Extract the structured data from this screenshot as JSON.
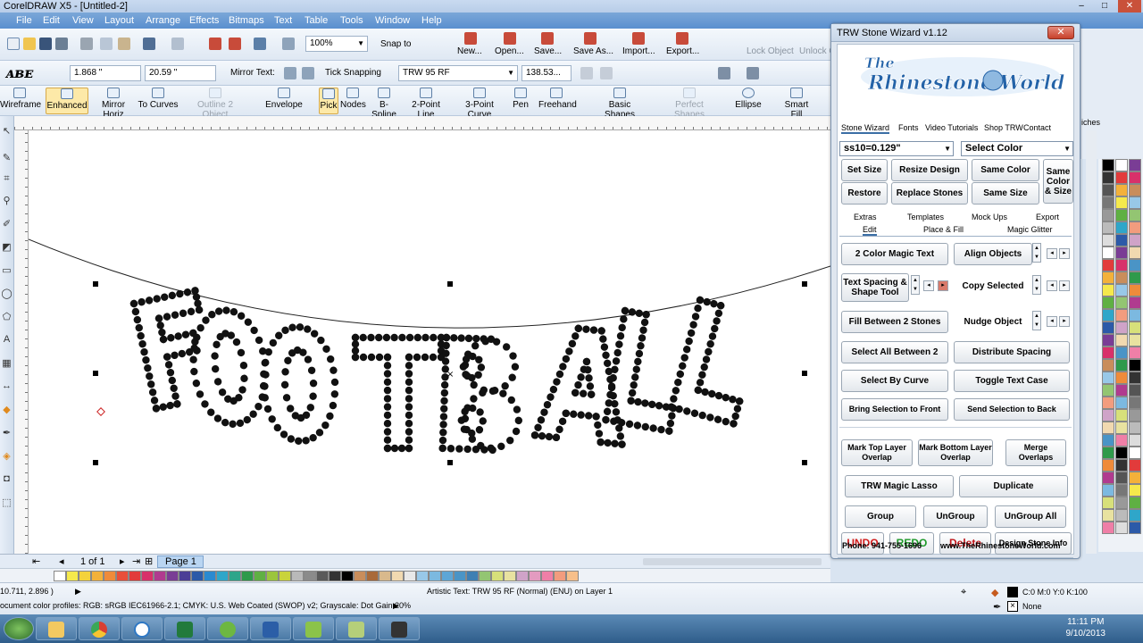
{
  "window": {
    "title": "CorelDRAW X5 - [Untitled-2]"
  },
  "menu": [
    "File",
    "Edit",
    "View",
    "Layout",
    "Arrange",
    "Effects",
    "Bitmaps",
    "Text",
    "Table",
    "Tools",
    "Window",
    "Help"
  ],
  "toolbar1": {
    "zoom": "100%",
    "snap_to": "Snap to",
    "new": "New...",
    "open": "Open...",
    "save": "Save...",
    "save_as": "Save As...",
    "import": "Import...",
    "export": "Export...",
    "lock_object": "Lock Object",
    "unlock_object": "Unlock O"
  },
  "toolbar2": {
    "width": "1.868 \"",
    "height": "20.59 \"",
    "mirror_text": "Mirror Text:",
    "tick_snapping": "Tick Snapping",
    "font": "TRW 95 RF",
    "size": "138.53..."
  },
  "toolbar3": [
    "Wireframe",
    "Enhanced",
    "Mirror Horiz",
    "To Curves",
    "Outline 2 Object",
    "Envelope",
    "Pick",
    "Nodes",
    "B-Spline",
    "2-Point Line",
    "3-Point Curve",
    "Pen",
    "Freehand",
    "Basic Shapes",
    "Perfect Shapes",
    "Ellipse",
    "Smart Fill"
  ],
  "pagebar": {
    "count": "1 of 1",
    "tab": "Page 1"
  },
  "status": {
    "coords": "10.711, 2.896 )",
    "object": "Artistic Text: TRW 95 RF (Normal) (ENU) on Layer 1",
    "profile": "ocument color profiles: RGB: sRGB IEC61966-2.1; CMYK: U.S. Web Coated (SWOP) v2; Grayscale: Dot Gain 20%",
    "fill": "C:0 M:0 Y:0 K:100",
    "outline": "None"
  },
  "clock": {
    "time": "11:11 PM",
    "date": "9/10/2013"
  },
  "dock": {
    "label": "iches"
  },
  "wizard": {
    "title": "TRW Stone Wizard v1.12",
    "close": "✕",
    "logo_top": "The",
    "logo_main": "Rhinestone World",
    "tabs": [
      "Stone Wizard",
      "Fonts",
      "Video Tutorials",
      "Shop TRW",
      "Contact"
    ],
    "stone_size": "ss10=0.129\"",
    "color_select": "Select Color",
    "set_size": "Set Size",
    "resize_design": "Resize Design",
    "same_color": "Same Color",
    "same_color_size": "Same Color & Size",
    "restore": "Restore",
    "replace_stones": "Replace Stones",
    "same_size": "Same Size",
    "subtabs_row1": [
      "Extras",
      "Templates",
      "Mock Ups",
      "Export"
    ],
    "subtabs_row2": [
      "Edit",
      "Place & Fill",
      "Magic Glitter"
    ],
    "two_color": "2 Color Magic Text",
    "align_objects": "Align Objects",
    "text_spacing": "Text Spacing & Shape Tool",
    "copy_selected": "Copy Selected",
    "fill_between": "Fill Between 2 Stones",
    "nudge_object": "Nudge Object",
    "select_all_between": "Select All Between 2",
    "distribute_spacing": "Distribute Spacing",
    "select_by_curve": "Select By Curve",
    "toggle_text_case": "Toggle Text Case",
    "bring_front": "Bring Selection to Front",
    "send_back": "Send Selection to Back",
    "mark_top": "Mark Top Layer Overlap",
    "mark_bottom": "Mark Bottom Layer Overlap",
    "merge_overlaps": "Merge Overlaps",
    "magic_lasso": "TRW Magic Lasso",
    "duplicate": "Duplicate",
    "group": "Group",
    "ungroup": "UnGroup",
    "ungroup_all": "UnGroup All",
    "undo": "UNDO",
    "redo": "REDO",
    "delete": "Delete",
    "design_info": "Design Stone Info",
    "phone": "Phone: 941-755-1696",
    "website": "www.TheRhinestoneWorld.com"
  },
  "colors": {
    "undo": "#d21c1c",
    "redo": "#1e9a2a",
    "delete": "#c0171b",
    "accent": "#3b6ea5"
  }
}
